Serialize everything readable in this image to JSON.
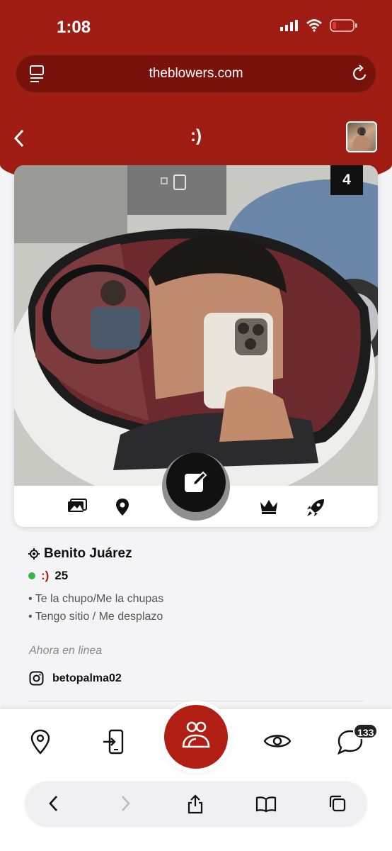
{
  "status": {
    "time": "1:08"
  },
  "browser": {
    "url": "theblowers.com"
  },
  "nav": {
    "title": ":)"
  },
  "profile": {
    "photo_count": "4",
    "location": "Benito Juárez",
    "smiley": ":)",
    "age": "25",
    "bullets": [
      "• Te la chupo/Me la chupas",
      "• Tengo sitio / Me desplazo"
    ],
    "online_text": "Ahora en linea",
    "instagram": "betopalma02"
  },
  "tabbar": {
    "messages_badge": "133"
  },
  "colors": {
    "brand": "#a01d14",
    "online": "#3bb54a"
  }
}
